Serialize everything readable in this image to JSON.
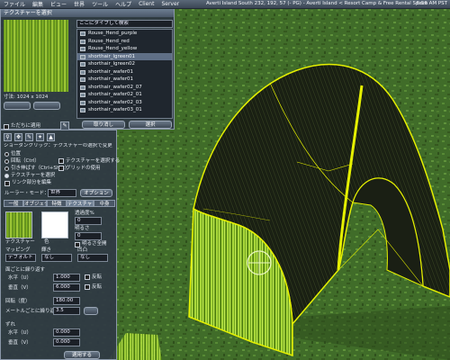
{
  "menubar": {
    "items": [
      "ファイル",
      "編集",
      "ビュー",
      "世界",
      "ツール",
      "ヘルプ",
      "Client",
      "Server"
    ],
    "location": "Averti Island South 232, 192, 57 (- PG) - Averti Island < Resort Camp & Free Rental Space",
    "clock": "8:56 AM PST"
  },
  "texture_picker": {
    "title": "テクスチャーを選択",
    "size_label": "寸法: 1024 x 1024",
    "search_placeholder": "ここにタイプして検索",
    "items": [
      {
        "label": "Rouse_Hend_purple",
        "selected": false
      },
      {
        "label": "Rouse_Hend_red",
        "selected": false
      },
      {
        "label": "Rouse_Hend_yellow",
        "selected": false
      },
      {
        "label": "shorthair_lgreen01",
        "selected": true
      },
      {
        "label": "shorthair_lgreen02",
        "selected": false
      },
      {
        "label": "shorthair_wafer01",
        "selected": false
      },
      {
        "label": "shorthair_wafer01",
        "selected": false
      },
      {
        "label": "shorthair_wafer02_07",
        "selected": false
      },
      {
        "label": "shorthair_wafer02_01",
        "selected": false
      },
      {
        "label": "shorthair_wafer02_03",
        "selected": false
      },
      {
        "label": "shorthair_wafer03_01",
        "selected": false
      }
    ],
    "apply_now_label": "ただちに適用",
    "cancel_label": "取り消し",
    "select_label": "選択"
  },
  "build_panel": {
    "mode_line": "ショーダンクリック：テクスチャーの選択で変更",
    "options": [
      "位置",
      "回転（Ctrl）",
      "引き伸ばす（Ctrl+Shift）",
      "テクスチャーを選択"
    ],
    "options_right": [
      "テクスチャーを選択する",
      "グリッドの使用"
    ],
    "link_parts_label": "リンク部分を編集",
    "ruler_label": "ルーラー・モード：",
    "ruler_value": "世界",
    "edit_button": "オプション",
    "tabs": [
      "一般",
      "オブジェクト",
      "特徴",
      "テクスチャー",
      "中身"
    ],
    "texture_label": "テクスチャー",
    "color_label": "色",
    "transparency_label": "透過度%",
    "transparency_value": "0",
    "glow_label": "明るさ",
    "glow_value": "0",
    "fullbright_label": "明るさ全開",
    "mapping_label": "マッピング",
    "mapping_value": "デフォルト",
    "shininess_label": "輝き",
    "shininess_value": "なし",
    "bumpiness_label": "凹凸",
    "bumpiness_value": "なし",
    "repeats_label": "面ごとに繰り返す",
    "h_label": "水平（U）",
    "h_value": "1.000",
    "v_label": "垂直（V）",
    "v_value": "6.000",
    "flip_label": "反転",
    "rotation_label": "回転（度）",
    "rotation_value": "180.00",
    "per_meter_label": "メートルごとに繰り返す",
    "per_meter_value": "3.5",
    "offset_label": "ずれ",
    "offset_h_label": "水平（U）",
    "offset_h_value": "0.000",
    "offset_v_label": "垂直（V）",
    "offset_v_value": "0.000",
    "apply_button": "適用する"
  },
  "colors": {
    "panel_bg": "#2f3844",
    "selection_outline": "#e5f000",
    "hair_green": "#9ccb2c",
    "grass": "#3f6a28"
  }
}
